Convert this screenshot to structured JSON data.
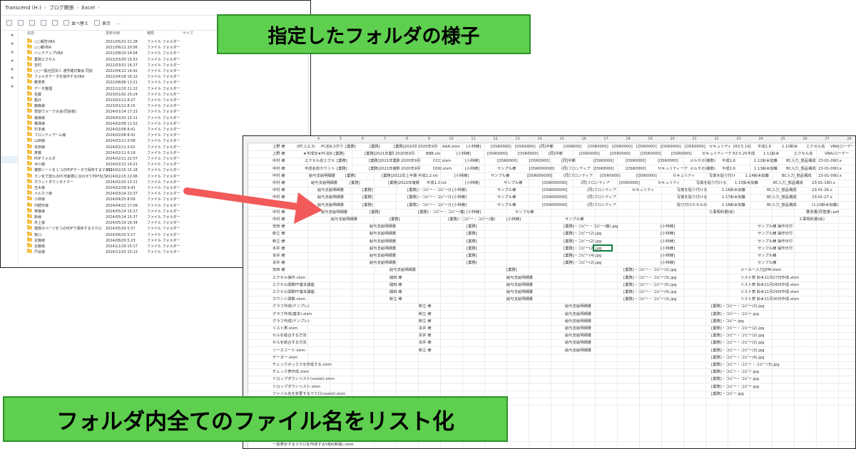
{
  "explorer": {
    "breadcrumb": [
      "Transcend (H:)",
      "ブログ関係",
      "Excel"
    ],
    "toolbar": {
      "sort_label": "並べ替え",
      "view_label": "表示",
      "more_label": "..."
    },
    "columns": {
      "name": "名前",
      "date": "更新日時",
      "type": "種類",
      "size": "サイズ"
    },
    "files": [
      {
        "name": "○○報告VBA",
        "date": "2021/05/21 21:28",
        "type": "ファイル フォルダー"
      },
      {
        "name": "○○報VBA",
        "date": "2021/06/11 20:56",
        "type": "ファイル フォルダー"
      },
      {
        "name": "バックアップVBA",
        "date": "2021/08/10 14:04",
        "type": "ファイル フォルダー"
      },
      {
        "name": "業務エクセル",
        "date": "2022/03/30 15:53",
        "type": "ファイル フォルダー"
      },
      {
        "name": "吉村",
        "date": "2022/03/31 16:27",
        "type": "ファイル フォルダー"
      },
      {
        "name": "○○一般社団法人 通学路対策会 同窓",
        "date": "2022/04/12 14:42",
        "type": "ファイル フォルダー"
      },
      {
        "name": "フォルダデータを操作するVBA",
        "date": "2022/04/18 16:12",
        "type": "ファイル フォルダー"
      },
      {
        "name": "教育表",
        "date": "2022/08/06 13:21",
        "type": "ファイル フォルダー"
      },
      {
        "name": "データ整理",
        "date": "2022/12/10 21:22",
        "type": "ファイル フォルダー"
      },
      {
        "name": "佐藤",
        "date": "2023/01/02 20:24",
        "type": "ファイル フォルダー"
      },
      {
        "name": "集計",
        "date": "2023/01/11 8:27",
        "type": "ファイル フォルダー"
      },
      {
        "name": "藤森様",
        "date": "2023/01/11 8:15",
        "type": "ファイル フォルダー"
      },
      {
        "name": "草創ウォーク大会(同窓様)",
        "date": "2024/01/14 17:23",
        "type": "ファイル フォルダー"
      },
      {
        "name": "篠様様",
        "date": "2024/02/02 15:11",
        "type": "ファイル フォルダー"
      },
      {
        "name": "横溝様",
        "date": "2024/02/08 11:52",
        "type": "ファイル フォルダー"
      },
      {
        "name": "杉本様",
        "date": "2024/02/08 8:41",
        "type": "ファイル フォルダー"
      },
      {
        "name": "フロンティアーム様",
        "date": "2024/02/08 8:42",
        "type": "ファイル フォルダー"
      },
      {
        "name": "山田様",
        "date": "2024/02/11 0:08",
        "type": "ファイル フォルダー"
      },
      {
        "name": "本田様",
        "date": "2024/02/11 0:02",
        "type": "ファイル フォルダー"
      },
      {
        "name": "斉藤",
        "date": "2024/02/11 6:18",
        "type": "ファイル フォルダー"
      },
      {
        "name": "PDFフォルダ",
        "date": "2024/02/11 22:57",
        "type": "ファイル フォルダー"
      },
      {
        "name": "木川様",
        "date": "2024/02/12 14:21",
        "type": "ファイル フォルダー"
      },
      {
        "name": "複数シートを１つのPDFデータで保存するマクロ",
        "date": "2024/02/15 15:18",
        "type": "ファイル フォルダー"
      },
      {
        "name": "ラン化で変わるPC年齢数に合わせてPDF出力",
        "date": "2024/02/15 22:06",
        "type": "ファイル フォルダー"
      },
      {
        "name": "カウントダウンタイマー",
        "date": "2024/02/20 13:11",
        "type": "ファイル フォルダー"
      },
      {
        "name": "玉木様",
        "date": "2024/02/28 9:43",
        "type": "ファイル フォルダー"
      },
      {
        "name": "メルカリ様",
        "date": "2024/03/14 23:37",
        "type": "ファイル フォルダー"
      },
      {
        "name": "小林様",
        "date": "2024/04/20 8:09",
        "type": "ファイル フォルダー"
      },
      {
        "name": "円経形様",
        "date": "2024/04/22 17:09",
        "type": "ファイル フォルダー"
      },
      {
        "name": "斉藤様",
        "date": "2024/05/14 15:17",
        "type": "ファイル フォルダー"
      },
      {
        "name": "斯様",
        "date": "2024/05/14 15:37",
        "type": "ファイル フォルダー"
      },
      {
        "name": "井上様",
        "date": "2024/05/14 16:34",
        "type": "ファイル フォルダー"
      },
      {
        "name": "複数のページをつのPDFで保存するマクロ",
        "date": "2024/05/29 5:37",
        "type": "ファイル フォルダー"
      },
      {
        "name": "後口",
        "date": "2024/06/20 5:17",
        "type": "ファイル フォルダー"
      },
      {
        "name": "近藤様",
        "date": "2024/08/20 5:23",
        "type": "ファイル フォルダー"
      },
      {
        "name": "近藤様",
        "date": "2024/11/19 15:17",
        "type": "ファイル フォルダー"
      },
      {
        "name": "戸谷様",
        "date": "2024/11/03 15:13",
        "type": "ファイル フォルダー"
      }
    ]
  },
  "excel": {
    "col_numbers": [
      "4",
      "5",
      "6",
      "7",
      "8",
      "9",
      "10",
      "11",
      "12",
      "13",
      "14",
      "15",
      "16",
      "17",
      "18",
      "19",
      "20",
      "21",
      "22",
      "23",
      "24",
      "25",
      "26",
      "27",
      "28",
      "29",
      "30"
    ],
    "rows": [
      [
        "上野 様",
        "(RT,1,2,3)",
        "PC名6,3方ウ",
        "[業務]",
        "[業務]",
        "[業務]2020年1月",
        "2020年9月",
        "AAA.xlsm",
        "[小林様]",
        "[DSR0000]",
        "[DSR0000]",
        "[同]中断",
        "[DSR000]",
        "[DSR0000]",
        "[DSR0000]",
        "[DSR0000]",
        "[DSR0000]",
        "[DSR0000]",
        "セキュリティー",
        "[R3.5.19]",
        "平成1,6",
        "1.10鈴木",
        "エクセル名",
        "VBA(ローデー"
      ],
      [
        "上野 様",
        "★平成年★PC名6,3方ウ",
        "[業務]",
        "[業務]2021年業務バンド",
        "2020年9月",
        "BBB.xls",
        "[小林様]",
        "[DSR0000]",
        "[DSR0000]",
        "[同]中断",
        "[DSR0000]",
        "[DSR0000]",
        "[DSR0000]",
        "[DSR0000]",
        "セキュリティーデ",
        "R3.5.25平成",
        "1.11鈴木",
        "エクセル名",
        "VBA(ローデー"
      ],
      [
        "中村 様",
        "エクセル名エクセル名",
        "[業務]",
        "[業務]2021年業務",
        "2020年9月",
        "CCC.xlsm",
        "[小林様]",
        "[DSR0000]",
        "[DSR0000]",
        "[同]中断",
        "[DSR0000]",
        "[DSR0000]",
        "[DSR0000]",
        "メルサガ(複数)",
        "平成1,6",
        "1.12鈴木加藤",
        "BC入力_部品構成",
        "23-01-09D.x"
      ],
      [
        "中村 様",
        "平成名前カウントの",
        "[業務]",
        "[業務]2021年複数バンド",
        "2020年9月",
        "DDD.xlsm",
        "[小林様]",
        "サンプル様",
        "[DSR000000]",
        "(同)フロンティア",
        "[DSR0000]",
        "[DSR0000]",
        "セキュリティーデ",
        "メルサガ(複数)",
        "平成1,6",
        "1.13鈴木加藤",
        "BC入力_部品構成",
        "23-01-09D.x"
      ],
      [
        "中村 様",
        "給与支給明細書",
        "[業務]",
        "[業務]2022年上半期",
        "平成1,2.txt",
        "[小林様]",
        "サンプル様",
        "[DSR000000]",
        "(同)フロンティア",
        "[DSR0000]",
        "[DSR0000]",
        "セキュリティ",
        "写真を貼り付け",
        "1.14鈴木加藤",
        "BC入力_部品構成",
        "23-01-09D.x"
      ],
      [
        "中村 様",
        "給与支給明細書",
        "[業務]",
        "[業務]2022年複数",
        "平成1,3.txt",
        "[小林様]",
        "サンプル様",
        "[DSR000000]",
        "(同)フロンティア",
        "[DSR0000]",
        "セキュリティ",
        "写真を貼り付ける",
        "1.15鈴木加藤",
        "BC入力_部品構成",
        "23-01-18D.x"
      ],
      [
        "中村 様",
        "給与支給明細書",
        "[業務]",
        "[業務]・コピー・コピー(複)",
        "[小林様]",
        "サンプル様",
        "[DSR000000]",
        "(同)フロンティア",
        "セキュリティ",
        "写真を貼り付ける",
        "1.16鈴木加藤",
        "BC入力_部品構成",
        "23-01-26.x"
      ],
      [
        "中村 様",
        "給与支給明細書",
        "[業務]",
        "[業務]・コピー・コピー(複)",
        "[小林様]",
        "サンプル様",
        "[DSR000000]",
        "(同)フロンティア",
        "",
        "写真を貼り付ける",
        "1.17鈴木加藤",
        "BC入力_部品構成",
        "23-01-27.x"
      ],
      [
        "中村 様",
        "給与支給明細書",
        "[業務]",
        "[業務]・コピー・コピー(複)",
        "[小林様]",
        "サンプル様",
        "[DSR000000]",
        "(同)フロンティア",
        "",
        "貼り付けたセルの",
        "1.18鈴木加藤",
        "BC入力_部品構成",
        "(1.10鈴木加藤)"
      ],
      [
        "中村 様",
        "給与支給明細書",
        "[業務]",
        "[業務]・コピー・コピー(複)",
        "[小林様]",
        "サンプル様",
        "",
        "",
        "",
        "工事契約書(仮)",
        "",
        "要求書(同意書).pdf"
      ],
      [
        "中村 様",
        "給与支給明細書",
        "[業務]",
        "[業務]・コピー・コピー(複)",
        "[小林様]",
        "サンプル様",
        "",
        "",
        "",
        "工事契約書(仮)"
      ],
      [
        "安田 様",
        "給与支給明細書",
        "[業務]",
        "[業務]・コピー・コピー(複).jpg",
        "[小林様]",
        "サンプル様 操作日付"
      ],
      [
        "新立 様",
        "給与支給明細書",
        "[業務]",
        "[業務]・コピー(2).jpg",
        "[小林様]",
        "サンプル様 操作日付"
      ],
      [
        "新立 様",
        "給与支給明細書",
        "[業務]",
        "[業務]・コピー(2).jpg",
        "[小林様]",
        "サンプル様 操作日付"
      ],
      [
        "本井 様",
        "給与支給明細書",
        "[業務]",
        "[業務]・コピー(2).jpg",
        "[小林様]",
        "サンプル様 操作日付"
      ],
      [
        "本井 様",
        "給与支給明細書",
        "[業務]",
        "[業務]・コピー(4).jpg",
        "[小林様]",
        "サンプル様"
      ],
      [
        "本井 様",
        "給与支給明細書",
        "[業務]",
        "[業務]・コピー(2).jpg",
        "[小林様]",
        "サンプル様"
      ],
      [
        "安田 様",
        "給与支給明細書",
        "[業務]",
        "[業務]・コピー・コピー(2).jpg",
        "メールー入力[JPM.xlsm"
      ],
      [
        "エクセル操作.xlsm",
        "開田 様",
        "給与支給明細書",
        "[業務]・コピー・コピー(3).jpg",
        "リスト表 鈴木11月27日作成.xlsm"
      ],
      [
        "エクセル関数FF基本講座",
        "開田 様",
        "給与支給明細書",
        "[業務]・コピー・コピー(5).jpg",
        "リスト表 鈴木11月28日作成.xlsm"
      ],
      [
        "エクセル関数FF基本講座",
        "開田 様",
        "給与支給明細書",
        "[業務]・コピー・コピー(4).jpg",
        "リスト表 鈴木11月29日作成.xlsm"
      ],
      [
        "カウント関数.xlsm",
        "新立 様",
        "給与支給明細書",
        "[業務]・コピー・コピー(3).jpg",
        "リスト表 鈴木11月30日作成.xlsm"
      ],
      [
        "グラフ作成(テンプレ)",
        "新立 様",
        "給与支給明細書",
        "[業務]・コピー・コピー(3).jpg"
      ],
      [
        "グラフ作成(基本).xlsm",
        "新立 様",
        "給与支給明細書",
        "[業務]・コピー・コピー.jpg"
      ],
      [
        "グラフ作成(テンプレ)",
        "新立 様",
        "給与支給明細書",
        "[業務]・コピー.jpg"
      ],
      [
        "リスト表.xlsm",
        "本井 様",
        "給与支給明細書",
        "[業務]・コピー・コピー(2).jpg"
      ],
      [
        "セルを結合する方法",
        "本井 様",
        "給与支給明細書",
        "[業務]・コピー・コピー(2).jpg"
      ],
      [
        "セルを結合する方法",
        "本井 様",
        "給与支給明細書",
        "[業務]・コピー・コピー(2).jpg"
      ],
      [
        "ソースコード.xlsm",
        "新立 様",
        "給与支給明細書",
        "[業務]・コピー・コピー(3).jpg"
      ],
      [
        "データー.xlsm",
        "",
        "",
        "[業務]・コピー・コピー(4).jpg"
      ],
      [
        "チェックボックスを作成する.xlsm",
        "",
        "",
        "[業務]・コピー・コピー・コピー(5).jpg"
      ],
      [
        "チェック表作成.xlsm",
        "",
        "",
        "[業務]・コピー・コピー.jpg"
      ],
      [
        "ドロップダウンリスト(vsstel).xlsm",
        "",
        "",
        "[業務]・コピー・コピー.jpg"
      ],
      [
        "ドロップダウンリスト.xlsm",
        "",
        "",
        "[業務]・コピー・コピー.jpg"
      ],
      [
        "ファイル名を変更するマクロ(vsstel).xlsm",
        "",
        "",
        "[業務]・コピー.jpg"
      ],
      [
        "ファイル名を変更するマクロ.xlsm"
      ]
    ],
    "tail_rows": [
      "一括表示するマクロを作成するVBA.xlsm",
      "一括表示するマクロを作成するVBA(新版).xlsm"
    ]
  },
  "banner_top": "指定したフォルダの様子",
  "banner_bottom": "フォルダ内全てのファイル名をリスト化",
  "colors": {
    "banner_fill": "#5fcf4f",
    "banner_border": "#2f8f2a",
    "arrow": "#f25a5a",
    "folder": "#f6c34a",
    "excel_select": "#107c41"
  }
}
